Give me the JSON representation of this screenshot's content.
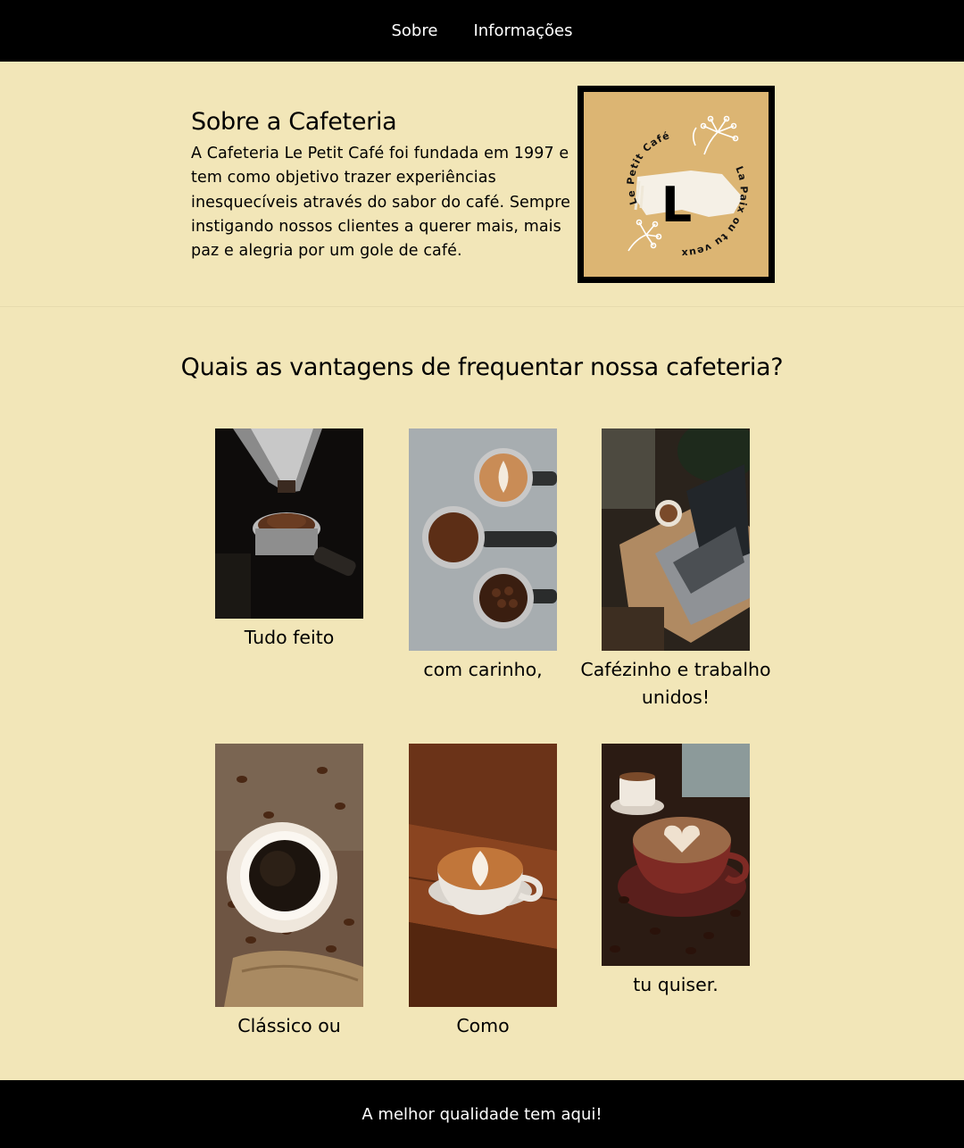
{
  "nav": {
    "items": [
      {
        "label": "Sobre"
      },
      {
        "label": "Informações"
      }
    ]
  },
  "about": {
    "title": "Sobre a Cafeteria",
    "text": "A Cafeteria Le Petit Café foi fundada em 1997 e tem como objetivo trazer experiências inesquecíveis através do sabor do café. Sempre instigando nossos clientes a querer mais, mais paz e alegria por um gole de café.",
    "logo": {
      "letter": "L",
      "arc_top": "Le Petit Café",
      "arc_bottom": "La Paix ou tu veux",
      "icon": "coffee-logo-icon"
    }
  },
  "advantages": {
    "title": "Quais as vantagens de frequentar nossa cafeteria?",
    "cards": [
      {
        "caption": "Tudo feito",
        "image": "espresso-grinder-photo"
      },
      {
        "caption": "com carinho,",
        "image": "portafilters-photo"
      },
      {
        "caption": "Cafézinho e trabalho unidos!",
        "image": "laptop-coffee-photo"
      },
      {
        "caption": "Clássico ou",
        "image": "coffee-beans-cup-photo"
      },
      {
        "caption": "Como",
        "image": "latte-art-table-photo"
      },
      {
        "caption": "tu quiser.",
        "image": "heart-latte-photo"
      }
    ]
  },
  "footer": {
    "text": "A melhor qualidade tem aqui!"
  },
  "colors": {
    "background": "#f2e6b8",
    "nav_bg": "#000000",
    "logo_bg": "#dcb573"
  }
}
